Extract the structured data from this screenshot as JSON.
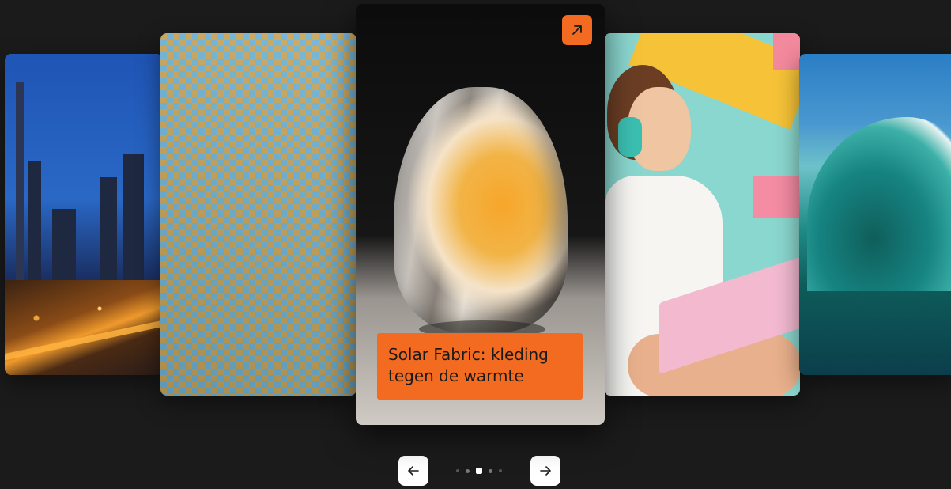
{
  "carousel": {
    "featured_caption": "Solar Fabric: kleding tegen de warmte",
    "accent_color": "#f26b21",
    "slides": [
      {
        "subject": "city-skyline-night"
      },
      {
        "subject": "solar-panel-field"
      },
      {
        "subject": "mirrored-sculpture"
      },
      {
        "subject": "girl-with-headphones-laptop"
      },
      {
        "subject": "ocean-wave"
      }
    ],
    "active_index": 2,
    "dot_count": 5,
    "icons": {
      "open": "arrow-up-right-icon",
      "previous": "arrow-left-icon",
      "next": "arrow-right-icon"
    }
  }
}
